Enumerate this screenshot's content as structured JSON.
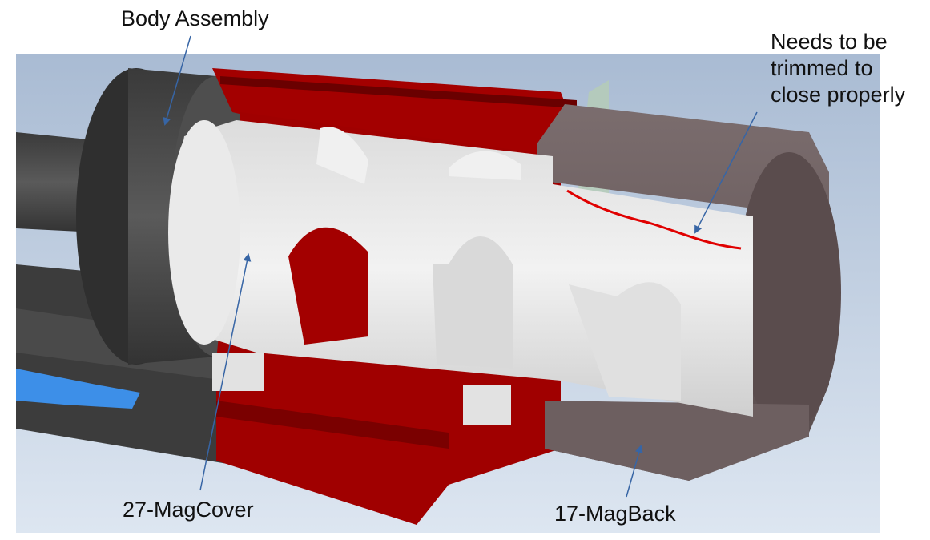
{
  "annotations": {
    "body_assembly": "Body Assembly",
    "needs_trim": "Needs to be\ntrimmed to\nclose properly",
    "mag_cover": "27-MagCover",
    "mag_back": "17-MagBack"
  },
  "colors": {
    "viewport_top": "#a9bbd3",
    "viewport_bottom": "#dbe4f0",
    "dark_part": "#444444",
    "red_part": "#a30000",
    "white_part": "#e6e6e6",
    "brown_part": "#6a5b5c",
    "blue_part": "#3d8fe8",
    "arrow": "#3765a5",
    "trim_line": "#e00000"
  }
}
